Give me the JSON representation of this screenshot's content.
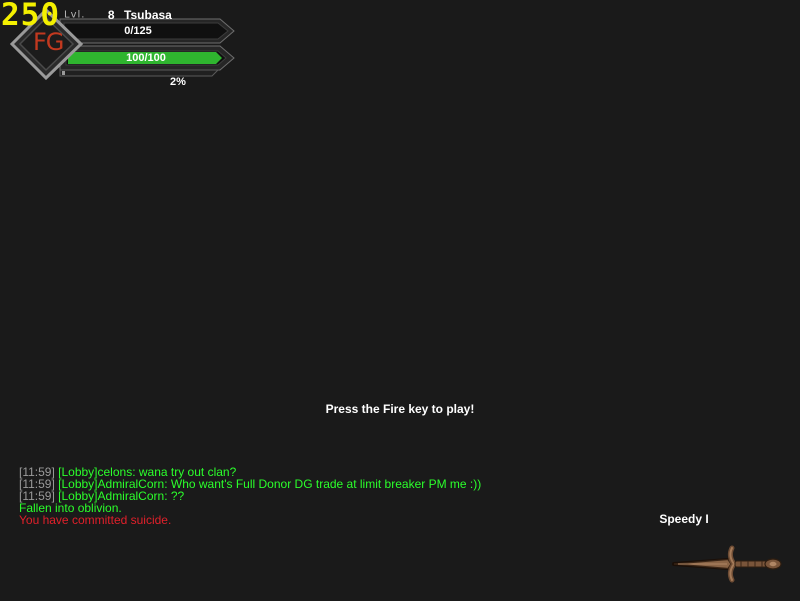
{
  "hud": {
    "fps": "250",
    "emblem_text": "FG",
    "level_label": "Lvl.",
    "level": "8",
    "player_name": "Tsubasa",
    "xp_text": "0/125",
    "xp_fraction": 0,
    "hp_text": "100/100",
    "hp_fraction": 1.0,
    "third_bar_text": "2%",
    "third_bar_fraction": 0.02
  },
  "prompt": "Press the Fire key to play!",
  "chat": [
    {
      "timestamp": "[11:59]",
      "text": " [Lobby]celons: wana try out clan?",
      "color": "green"
    },
    {
      "timestamp": "[11:59]",
      "text": " [Lobby]AdmiralCorn: Who want's Full Donor DG  trade at limit breaker PM me :))",
      "color": "green"
    },
    {
      "timestamp": "[11:59]",
      "text": " [Lobby]AdmiralCorn: ??",
      "color": "green"
    },
    {
      "timestamp": "",
      "text": "Fallen into oblivion.",
      "color": "green"
    },
    {
      "timestamp": "",
      "text": "You have committed suicide.",
      "color": "red"
    }
  ],
  "weapon": {
    "name": "Speedy I",
    "icon": "dagger-icon"
  },
  "colors": {
    "background": "#1a1a1a",
    "fps": "#f4f000",
    "hp_bar": "#2fb52f",
    "chat_green": "#2bff2b",
    "chat_red": "#e0202a",
    "timestamp": "#9a9a9a"
  }
}
